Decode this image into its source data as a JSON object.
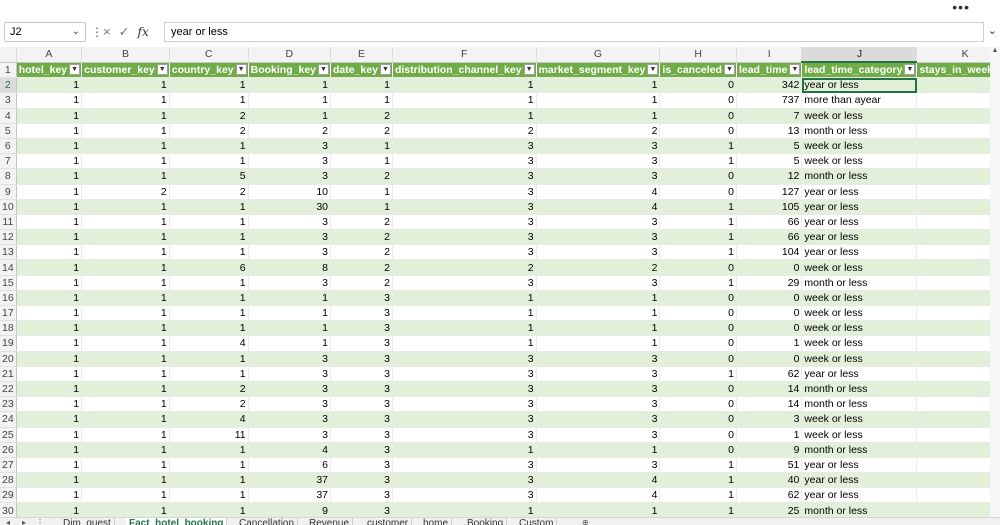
{
  "toolbar": {
    "more_label": "•••"
  },
  "formula_bar": {
    "name_box": "J2",
    "separator": "⋮",
    "cancel_icon": "×",
    "enter_icon": "✓",
    "fx_label": "fx",
    "value": "year or less"
  },
  "columns": [
    "A",
    "B",
    "C",
    "D",
    "E",
    "F",
    "G",
    "H",
    "I",
    "J",
    "K"
  ],
  "headers": [
    "hotel_key",
    "customer_key",
    "country_key",
    "Booking_key",
    "date_key",
    "distribution_channel_key",
    "market_segment_key",
    "is_canceled",
    "lead_time",
    "lead_time_category",
    "stays_in_weeke"
  ],
  "rows": [
    {
      "n": "2",
      "v": [
        "1",
        "1",
        "1",
        "1",
        "1",
        "1",
        "1",
        "0",
        "342",
        "year or less"
      ]
    },
    {
      "n": "3",
      "v": [
        "1",
        "1",
        "1",
        "1",
        "1",
        "1",
        "1",
        "0",
        "737",
        "more than ayear"
      ]
    },
    {
      "n": "4",
      "v": [
        "1",
        "1",
        "2",
        "1",
        "2",
        "1",
        "1",
        "0",
        "7",
        "week or less"
      ]
    },
    {
      "n": "5",
      "v": [
        "1",
        "1",
        "2",
        "2",
        "2",
        "2",
        "2",
        "0",
        "13",
        "month or less"
      ]
    },
    {
      "n": "6",
      "v": [
        "1",
        "1",
        "1",
        "3",
        "1",
        "3",
        "3",
        "1",
        "5",
        "week or less"
      ]
    },
    {
      "n": "7",
      "v": [
        "1",
        "1",
        "1",
        "3",
        "1",
        "3",
        "3",
        "1",
        "5",
        "week or less"
      ]
    },
    {
      "n": "8",
      "v": [
        "1",
        "1",
        "5",
        "3",
        "2",
        "3",
        "3",
        "0",
        "12",
        "month or less"
      ]
    },
    {
      "n": "9",
      "v": [
        "1",
        "2",
        "2",
        "10",
        "1",
        "3",
        "4",
        "0",
        "127",
        "year or less"
      ]
    },
    {
      "n": "10",
      "v": [
        "1",
        "1",
        "1",
        "30",
        "1",
        "3",
        "4",
        "1",
        "105",
        "year or less"
      ]
    },
    {
      "n": "11",
      "v": [
        "1",
        "1",
        "1",
        "3",
        "2",
        "3",
        "3",
        "1",
        "66",
        "year or less"
      ]
    },
    {
      "n": "12",
      "v": [
        "1",
        "1",
        "1",
        "3",
        "2",
        "3",
        "3",
        "1",
        "66",
        "year or less"
      ]
    },
    {
      "n": "13",
      "v": [
        "1",
        "1",
        "1",
        "3",
        "2",
        "3",
        "3",
        "1",
        "104",
        "year or less"
      ]
    },
    {
      "n": "14",
      "v": [
        "1",
        "1",
        "6",
        "8",
        "2",
        "2",
        "2",
        "0",
        "0",
        "week or less"
      ]
    },
    {
      "n": "15",
      "v": [
        "1",
        "1",
        "1",
        "3",
        "2",
        "3",
        "3",
        "1",
        "29",
        "month or less"
      ]
    },
    {
      "n": "16",
      "v": [
        "1",
        "1",
        "1",
        "1",
        "3",
        "1",
        "1",
        "0",
        "0",
        "week or less"
      ]
    },
    {
      "n": "17",
      "v": [
        "1",
        "1",
        "1",
        "1",
        "3",
        "1",
        "1",
        "0",
        "0",
        "week or less"
      ]
    },
    {
      "n": "18",
      "v": [
        "1",
        "1",
        "1",
        "1",
        "3",
        "1",
        "1",
        "0",
        "0",
        "week or less"
      ]
    },
    {
      "n": "19",
      "v": [
        "1",
        "1",
        "4",
        "1",
        "3",
        "1",
        "1",
        "0",
        "1",
        "week or less"
      ]
    },
    {
      "n": "20",
      "v": [
        "1",
        "1",
        "1",
        "3",
        "3",
        "3",
        "3",
        "0",
        "0",
        "week or less"
      ]
    },
    {
      "n": "21",
      "v": [
        "1",
        "1",
        "1",
        "3",
        "3",
        "3",
        "3",
        "1",
        "62",
        "year or less"
      ]
    },
    {
      "n": "22",
      "v": [
        "1",
        "1",
        "2",
        "3",
        "3",
        "3",
        "3",
        "0",
        "14",
        "month or less"
      ]
    },
    {
      "n": "23",
      "v": [
        "1",
        "1",
        "2",
        "3",
        "3",
        "3",
        "3",
        "0",
        "14",
        "month or less"
      ]
    },
    {
      "n": "24",
      "v": [
        "1",
        "1",
        "4",
        "3",
        "3",
        "3",
        "3",
        "0",
        "3",
        "week or less"
      ]
    },
    {
      "n": "25",
      "v": [
        "1",
        "1",
        "11",
        "3",
        "3",
        "3",
        "3",
        "0",
        "1",
        "week or less"
      ]
    },
    {
      "n": "26",
      "v": [
        "1",
        "1",
        "1",
        "4",
        "3",
        "1",
        "1",
        "0",
        "9",
        "month or less"
      ]
    },
    {
      "n": "27",
      "v": [
        "1",
        "1",
        "1",
        "6",
        "3",
        "3",
        "3",
        "1",
        "51",
        "year or less"
      ]
    },
    {
      "n": "28",
      "v": [
        "1",
        "1",
        "1",
        "37",
        "3",
        "3",
        "4",
        "1",
        "40",
        "year or less"
      ]
    },
    {
      "n": "29",
      "v": [
        "1",
        "1",
        "1",
        "37",
        "3",
        "3",
        "4",
        "1",
        "62",
        "year or less"
      ]
    },
    {
      "n": "30",
      "v": [
        "1",
        "1",
        "1",
        "9",
        "3",
        "1",
        "1",
        "1",
        "25",
        "month or less"
      ]
    }
  ],
  "sheet_tabs": [
    "Dim_guest",
    "Fact_hotel_booking",
    "Cancellation",
    "Revenue",
    "customer",
    "home",
    "Booking",
    "Custom"
  ],
  "tab_nav": {
    "prev": "◂",
    "next": "▸",
    "add": "⊕",
    "options": "⋮"
  },
  "colors": {
    "header_green": "#70ad47",
    "band_green": "#e2efd9",
    "accent": "#217346"
  }
}
